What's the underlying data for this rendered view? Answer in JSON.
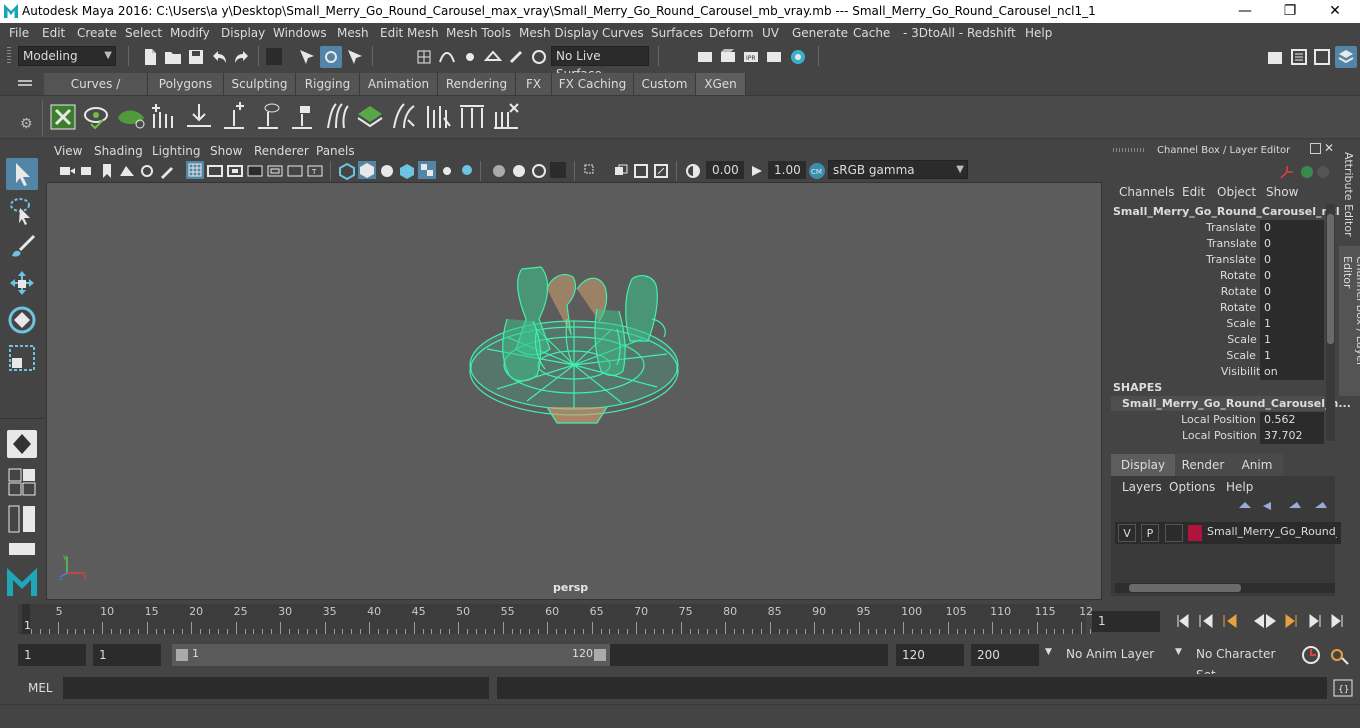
{
  "window": {
    "title": "Autodesk Maya 2016: C:\\Users\\a y\\Desktop\\Small_Merry_Go_Round_Carousel_max_vray\\Small_Merry_Go_Round_Carousel_mb_vray.mb   ---   Small_Merry_Go_Round_Carousel_ncl1_1",
    "minimize": "—",
    "maximize": "❐",
    "close": "✕"
  },
  "menubar": [
    "File",
    "Edit",
    "Create",
    "Select",
    "Modify",
    "Display",
    "Windows",
    "Mesh",
    "Edit Mesh",
    "Mesh Tools",
    "Mesh Display",
    "Curves",
    "Surfaces",
    "Deform",
    "UV",
    "Generate",
    "Cache",
    "- 3DtoAll -",
    "Redshift",
    "Help"
  ],
  "statusline": {
    "mode": "Modeling",
    "live_surface": "No Live Surface"
  },
  "shelf_tabs": [
    "Curves / Surfaces",
    "Polygons",
    "Sculpting",
    "Rigging",
    "Animation",
    "Rendering",
    "FX",
    "FX Caching",
    "Custom",
    "XGen"
  ],
  "active_shelf": "XGen",
  "panel_menu": [
    "View",
    "Shading",
    "Lighting",
    "Show",
    "Renderer",
    "Panels"
  ],
  "panel_toolbar": {
    "exposure": "0.00",
    "gamma": "1.00",
    "color_space": "sRGB gamma"
  },
  "viewport": {
    "camera": "persp"
  },
  "channel_box": {
    "header": "Channel Box / Layer Editor",
    "menu": [
      "Channels",
      "Edit",
      "Object",
      "Show"
    ],
    "object_name": "Small_Merry_Go_Round_Carousel_ncl...",
    "channels": [
      {
        "label": "Translate X",
        "value": "0"
      },
      {
        "label": "Translate Y",
        "value": "0"
      },
      {
        "label": "Translate Z",
        "value": "0"
      },
      {
        "label": "Rotate X",
        "value": "0"
      },
      {
        "label": "Rotate Y",
        "value": "0"
      },
      {
        "label": "Rotate Z",
        "value": "0"
      },
      {
        "label": "Scale X",
        "value": "1"
      },
      {
        "label": "Scale Y",
        "value": "1"
      },
      {
        "label": "Scale Z",
        "value": "1"
      },
      {
        "label": "Visibility",
        "value": "on"
      }
    ],
    "shapes_header": "SHAPES",
    "shape_name": "Small_Merry_Go_Round_Carousel_n...",
    "shape_channels": [
      {
        "label": "Local Position X",
        "value": "0.562"
      },
      {
        "label": "Local Position Y",
        "value": "37.702"
      }
    ]
  },
  "side_tabs": {
    "attribute_editor": "Attribute Editor",
    "channel_box": "Channel Box / Layer Editor"
  },
  "layer_editor": {
    "tabs": [
      "Display",
      "Render",
      "Anim"
    ],
    "active_tab": "Display",
    "menu": [
      "Layers",
      "Options",
      "Help"
    ],
    "layer": {
      "v": "V",
      "p": "P",
      "name": "Small_Merry_Go_Round_",
      "color": "#b0143c"
    }
  },
  "timeline": {
    "ticks": [
      "5",
      "10",
      "15",
      "20",
      "25",
      "30",
      "35",
      "40",
      "45",
      "50",
      "55",
      "60",
      "65",
      "70",
      "75",
      "80",
      "85",
      "90",
      "95",
      "100",
      "105",
      "110",
      "115",
      "12"
    ],
    "current_frame_label": "1",
    "current_frame": "1"
  },
  "range": {
    "start": "1",
    "playback_start": "1",
    "slider_start": "1",
    "slider_end": "120",
    "playback_end": "120",
    "end": "200",
    "anim_layer": "No Anim Layer",
    "character_set": "No Character Set"
  },
  "command_line": {
    "label": "MEL"
  }
}
